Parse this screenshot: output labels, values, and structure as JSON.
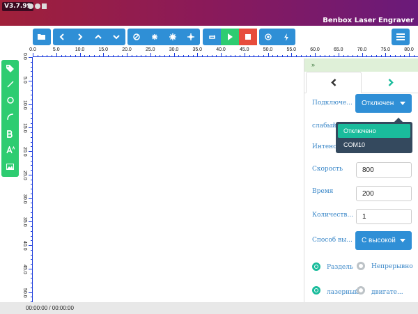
{
  "titlebar": {
    "version": "V3.7.99",
    "app_title": "Benbox Laser Engraver"
  },
  "colors": {
    "toolbar_blue": "#2f8fd6",
    "tools_green": "#2ecc71",
    "titlebar_start": "#a0203a",
    "titlebar_end": "#6a1a7a",
    "dropdown_bg": "#34495e",
    "dropdown_active": "#1abc9c",
    "label_blue": "#3a87c8",
    "ruler_blue": "#1a3adb"
  },
  "toolbar": {
    "file": "folder-open-icon",
    "move": [
      "arrow-left-icon",
      "arrow-right-icon",
      "arrow-up-icon",
      "arrow-down-icon"
    ],
    "transform": [
      "ban-icon",
      "asterisk-icon",
      "gear-icon",
      "crosshair-icon"
    ],
    "run": [
      "repeat-icon",
      "play-icon",
      "stop-icon"
    ],
    "extra": [
      "target-icon",
      "bolt-icon"
    ],
    "menu": "hamburger-menu-icon"
  },
  "ruler_x_labels": [
    "0.0",
    "5.0",
    "10.0",
    "15.0",
    "20.0",
    "25.0",
    "30.0",
    "35.0",
    "40.0",
    "45.0",
    "50.0",
    "55.0",
    "60.0",
    "65.0",
    "70.0",
    "75.0",
    "80.0"
  ],
  "ruler_y_labels": [
    "0.0",
    "5.0",
    "10.0",
    "15.0",
    "20.0",
    "25.0",
    "30.0",
    "35.0",
    "40.0",
    "45.0",
    "50.0"
  ],
  "left_tools": [
    "tag-icon",
    "line-icon",
    "circle-icon",
    "arc-icon",
    "bold-text-icon",
    "font-size-icon",
    "image-icon"
  ],
  "status": {
    "time": "00:00:00 / 00:00:00"
  },
  "panel": {
    "collapse_label": "»",
    "fields": {
      "connect_label": "Подключе...",
      "connect_value": "Отключен",
      "weak_label": "слабый",
      "intensity_label": "Интенси",
      "speed_label": "Скорость",
      "speed_value": "800",
      "time_label": "Время",
      "time_value": "200",
      "count_label": "Количеств...",
      "count_value": "1",
      "mode_label": "Способ вы...",
      "mode_value": "С высокой"
    },
    "dropdown_options": [
      "Отключено",
      "COM10"
    ],
    "radios": {
      "r1": "Раздель",
      "r2": "Непрерывно",
      "r3": "лазерный",
      "r4": "двигате..."
    }
  }
}
